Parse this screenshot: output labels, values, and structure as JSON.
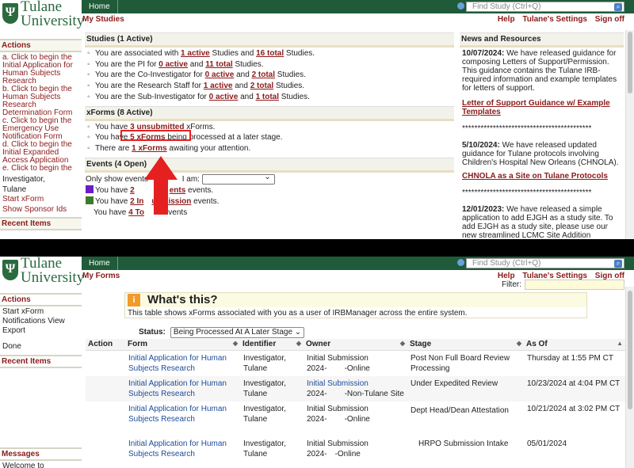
{
  "brand": {
    "line1": "Tulane",
    "line2": "University",
    "shield": "Ψ"
  },
  "nav": {
    "home": "Home",
    "search_placeholder": "Find Study (Ctrl+Q)"
  },
  "toplinks": [
    "Help",
    "Tulane's Settings",
    "Sign off"
  ],
  "screen1": {
    "title": "My Studies",
    "actions_title": "Actions",
    "actions": [
      "a. Click to begin the Initial Application for Human Subjects Research",
      "b. Click to begin the Human Subjects Research Determination Form",
      "c. Click to begin the Emergency Use Notification Form",
      "d. Click to begin the Initial Expanded Access Application",
      "e. Click to begin the"
    ],
    "sidebar_text": [
      "Investigator,",
      "Tulane"
    ],
    "sidebar_links": [
      "Start xForm",
      "Show Sponsor Ids"
    ],
    "recent_title": "Recent Items",
    "studies": {
      "title": "Studies (1 Active)",
      "rows": [
        {
          "pre": "You are associated with ",
          "l1": "1 active",
          "mid": " Studies and ",
          "l2": "16 total",
          "post": " Studies."
        },
        {
          "pre": "You are the PI for ",
          "l1": "0 active",
          "mid": " and ",
          "l2": "11 total",
          "post": " Studies."
        },
        {
          "pre": "You are the Co-Investigator for ",
          "l1": "0 active",
          "mid": " and ",
          "l2": "2 total",
          "post": " Studies."
        },
        {
          "pre": "You are the Research Staff for ",
          "l1": "1 active",
          "mid": " and ",
          "l2": "2 total",
          "post": " Studies."
        },
        {
          "pre": "You are the Sub-Investigator for ",
          "l1": "0 active",
          "mid": " and ",
          "l2": "1 total",
          "post": " Studies."
        }
      ]
    },
    "xforms": {
      "title": "xForms (8 Active)",
      "rows": [
        {
          "pre": "You have ",
          "link": "3 unsubmitted",
          "post": " xForms."
        },
        {
          "pre": "You have ",
          "link": "5 xForms",
          "post": " being processed at a later stage."
        },
        {
          "pre": "There are ",
          "link": "1 xForms",
          "post": " awaiting your attention."
        }
      ]
    },
    "events": {
      "title": "Events (4 Open)",
      "filter_label_a": "Only show events",
      "filter_label_b": "I am:",
      "row1_pre": "You have ",
      "row1_link_a": "2",
      "row1_link_b": "ents",
      "row1_post": " events.",
      "row2_pre": "You have ",
      "row2_link_a": "2 In",
      "row2_link_b": "ubmission",
      "row2_post": " events.",
      "row3_pre": "You have ",
      "row3_link": "4 To",
      "row3_post": " events",
      "swatch1": "#6a1cc9",
      "swatch2": "#3f7a2a"
    },
    "news": {
      "title": "News and Resources",
      "p1_date": "10/07/2024:",
      "p1_text": " We have released guidance for composing Letters of Support/Permission. This guidance contains the Tulane IRB-required information and example templates for letters of support.",
      "link1": "Letter of Support Guidance w/ Example Templates",
      "stars": "******************************************",
      "p2_date": "5/10/2024:",
      "p2_text": " We have released updated guidance for Tulane protocols involving Children's Hospital New Orleans (CHNOLA).",
      "link2": "CHNOLA as a Site on Tulane Protocols",
      "p3_date": "12/01/2023:",
      "p3_text": " We have released a simple application to add EJGH as a study site. To add EJGH as a study site, please use our new streamlined LCMC Site Addition Amendment form.  To access this form,"
    },
    "annotation_color": "#e52020"
  },
  "screen2": {
    "title": "My Forms",
    "filter_label": "Filter:",
    "actions_title": "Actions",
    "actions": [
      "Start xForm",
      "Notifications View",
      "Export",
      "Done"
    ],
    "recent_title": "Recent Items",
    "messages_title": "Messages",
    "messages_text": "Welcome to",
    "whats_icon": "i",
    "whats_title": "What's this?",
    "whats_body": "This table shows xForms associated with you as a user of IRBManager across the entire system.",
    "status_label": "Status:",
    "status_value": "Being Processed At A Later Stage",
    "columns": [
      "Action",
      "Form",
      "Identifier",
      "Owner",
      "Stage",
      "As Of"
    ],
    "rows": [
      {
        "form": "Initial Application for Human Subjects Research",
        "id1": "Investigator,",
        "id2": "Tulane",
        "own1": "Initial Submission",
        "own2a": "2024-",
        "own2b": "-Online",
        "stage": "Post Non Full Board Review Processing",
        "asof": "Thursday at 1:55 PM CT"
      },
      {
        "form": "Initial Application for Human Subjects Research",
        "id1": "Investigator,",
        "id2": "Tulane",
        "own1": "Initial Submission",
        "own2a": "2024-",
        "own2b": "-Non-Tulane Site",
        "stage": "Under Expedited Review",
        "asof": "10/23/2024 at 4:04 PM CT"
      },
      {
        "form": "Initial Application for Human Subjects Research",
        "id1": "Investigator,",
        "id2": "Tulane",
        "own1": "Initial Submission",
        "own2a": "2024-",
        "own2b": "-Online",
        "stage": "Dept Head/Dean Attestation",
        "asof": "10/21/2024 at 3:02 PM CT"
      },
      {
        "form": "Initial Application for Human Subjects Research",
        "id1": "Investigator,",
        "id2": "Tulane",
        "own1": "Initial Submission",
        "own2a": "2024-",
        "own2b": "-Online",
        "stage": "HRPO Submission Intake",
        "asof": "05/01/2024"
      }
    ]
  }
}
